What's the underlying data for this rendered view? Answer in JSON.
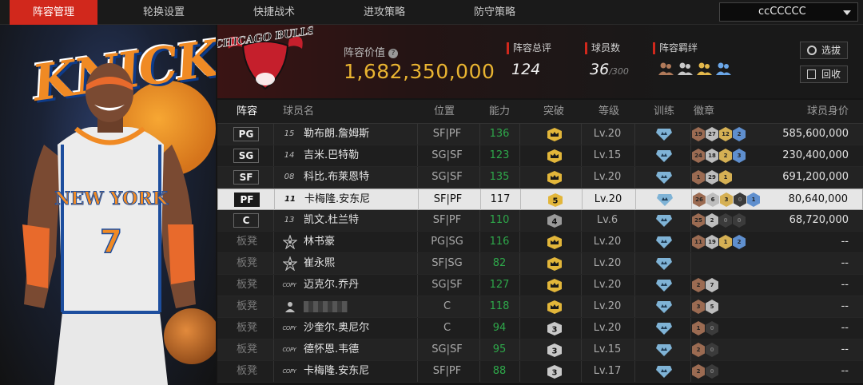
{
  "nav": {
    "tabs": [
      {
        "label": "阵容管理",
        "active": true
      },
      {
        "label": "轮换设置",
        "active": false
      },
      {
        "label": "快捷战术",
        "active": false
      },
      {
        "label": "进攻策略",
        "active": false
      },
      {
        "label": "防守策略",
        "active": false
      }
    ],
    "team_select": "ccCCCCC"
  },
  "left_panel": {
    "team_logo_text": "KNICKS",
    "jersey_team": "NEW YORK",
    "jersey_number": "7"
  },
  "header": {
    "logo_text": "CHICAGO BULLS",
    "lineup_value_label": "阵容价值",
    "lineup_value": "1,682,350,000",
    "total_rating_label": "阵容总评",
    "total_rating": "124",
    "player_count_label": "球员数",
    "player_count": "36",
    "player_count_max": "/300",
    "bond_label": "阵容羁绊",
    "select_button": "选拔",
    "recycle_button": "回收"
  },
  "table": {
    "headers": [
      "阵容",
      "球员名",
      "位置",
      "能力",
      "突破",
      "等级",
      "训练",
      "徽章",
      "球员身价"
    ],
    "rows": [
      {
        "slot": "PG",
        "jersey": "15",
        "name": "勒布朗.詹姆斯",
        "pos": "SF|PF",
        "ability": "136",
        "break": "crown",
        "level": "Lv.20",
        "badges": [
          [
            "19",
            "b-bronze"
          ],
          [
            "27",
            "b-silver"
          ],
          [
            "12",
            "b-gold"
          ],
          [
            "2",
            "b-blue"
          ]
        ],
        "value": "585,600,000",
        "bench": false
      },
      {
        "slot": "SG",
        "jersey": "14",
        "name": "吉米.巴特勒",
        "pos": "SG|SF",
        "ability": "123",
        "break": "crown",
        "level": "Lv.15",
        "badges": [
          [
            "24",
            "b-bronze"
          ],
          [
            "18",
            "b-silver"
          ],
          [
            "2",
            "b-gold"
          ],
          [
            "3",
            "b-blue"
          ]
        ],
        "value": "230,400,000",
        "bench": false
      },
      {
        "slot": "SF",
        "jersey": "08",
        "name": "科比.布莱恩特",
        "pos": "SG|SF",
        "ability": "135",
        "break": "crown",
        "level": "Lv.20",
        "badges": [
          [
            "1",
            "b-bronze"
          ],
          [
            "29",
            "b-silver"
          ],
          [
            "1",
            "b-gold"
          ]
        ],
        "value": "691,200,000",
        "bench": false
      },
      {
        "slot": "PF",
        "jersey": "11",
        "name": "卡梅隆.安东尼",
        "pos": "SF|PF",
        "ability": "117",
        "break": "5",
        "level": "Lv.20",
        "badges": [
          [
            "26",
            "b-bronze"
          ],
          [
            "6",
            "b-silver"
          ],
          [
            "3",
            "b-gold"
          ],
          [
            "0",
            "b-dark"
          ],
          [
            "1",
            "b-blue"
          ]
        ],
        "value": "80,640,000",
        "bench": false,
        "selected": true
      },
      {
        "slot": "C",
        "jersey": "13",
        "name": "凯文.杜兰特",
        "pos": "SF|PF",
        "ability": "110",
        "break": "4",
        "level": "Lv.6",
        "badges": [
          [
            "25",
            "b-bronze"
          ],
          [
            "2",
            "b-silver"
          ],
          [
            "0",
            "b-dark"
          ],
          [
            "0",
            "b-dark"
          ]
        ],
        "value": "68,720,000",
        "bench": false
      },
      {
        "slot": "板凳",
        "jersey": "star",
        "name": "林书豪",
        "pos": "PG|SG",
        "ability": "116",
        "break": "crown",
        "level": "Lv.20",
        "badges": [
          [
            "11",
            "b-bronze"
          ],
          [
            "19",
            "b-silver"
          ],
          [
            "1",
            "b-gold"
          ],
          [
            "2",
            "b-blue"
          ]
        ],
        "value": "--",
        "bench": true
      },
      {
        "slot": "板凳",
        "jersey": "star",
        "name": "崔永熙",
        "pos": "SF|SG",
        "ability": "82",
        "break": "crown",
        "level": "Lv.20",
        "badges": [],
        "value": "--",
        "bench": true
      },
      {
        "slot": "板凳",
        "jersey": "COPY",
        "name": "迈克尔.乔丹",
        "pos": "SG|SF",
        "ability": "127",
        "break": "crown",
        "level": "Lv.20",
        "badges": [
          [
            "2",
            "b-bronze"
          ],
          [
            "7",
            "b-silver"
          ]
        ],
        "value": "--",
        "bench": true
      },
      {
        "slot": "板凳",
        "jersey": "person",
        "name": "",
        "pos": "C",
        "ability": "118",
        "break": "crown",
        "level": "Lv.20",
        "badges": [
          [
            "3",
            "b-bronze"
          ],
          [
            "5",
            "b-silver"
          ]
        ],
        "value": "--",
        "bench": true
      },
      {
        "slot": "板凳",
        "jersey": "COPY",
        "name": "沙奎尔.奥尼尔",
        "pos": "C",
        "ability": "94",
        "break": "3",
        "level": "Lv.20",
        "badges": [
          [
            "1",
            "b-bronze"
          ],
          [
            "0",
            "b-dark"
          ]
        ],
        "value": "--",
        "bench": true
      },
      {
        "slot": "板凳",
        "jersey": "COPY",
        "name": "德怀恩.韦德",
        "pos": "SG|SF",
        "ability": "95",
        "break": "3",
        "level": "Lv.15",
        "badges": [
          [
            "2",
            "b-bronze"
          ],
          [
            "0",
            "b-dark"
          ]
        ],
        "value": "--",
        "bench": true
      },
      {
        "slot": "板凳",
        "jersey": "COPY",
        "name": "卡梅隆.安东尼",
        "pos": "SF|PF",
        "ability": "88",
        "break": "3",
        "level": "Lv.17",
        "badges": [
          [
            "2",
            "b-bronze"
          ],
          [
            "0",
            "b-dark"
          ]
        ],
        "value": "--",
        "bench": true
      }
    ]
  }
}
